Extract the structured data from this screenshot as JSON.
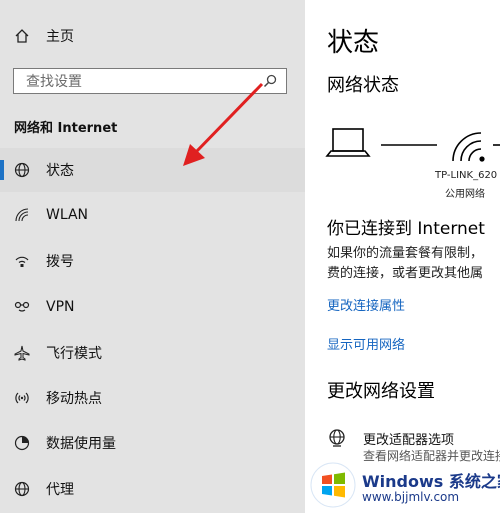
{
  "sidebar": {
    "home_label": "主页",
    "search_placeholder": "查找设置",
    "section_title": "网络和 Internet",
    "items": [
      {
        "label": "状态",
        "icon": "globe-icon",
        "active": true
      },
      {
        "label": "WLAN",
        "icon": "wifi-icon"
      },
      {
        "label": "拨号",
        "icon": "dialup-icon"
      },
      {
        "label": "VPN",
        "icon": "vpn-icon"
      },
      {
        "label": "飞行模式",
        "icon": "airplane-icon"
      },
      {
        "label": "移动热点",
        "icon": "hotspot-icon"
      },
      {
        "label": "数据使用量",
        "icon": "data-usage-icon"
      },
      {
        "label": "代理",
        "icon": "globe-icon"
      }
    ]
  },
  "main": {
    "title": "状态",
    "network_status_heading": "网络状态",
    "network_name": "TP-LINK_620",
    "network_type": "公用网络",
    "connected_text": "你已连接到 Internet",
    "desc_line1": "如果你的流量套餐有限制，",
    "desc_line2": "费的连接，或者更改其他属",
    "link_change_props": "更改连接属性",
    "link_show_networks": "显示可用网络",
    "change_settings_heading": "更改网络设置",
    "adapter_options_label": "更改适配器选项",
    "adapter_options_sub": "查看网络适配器并更改连接设置"
  },
  "watermark": {
    "brand": "Windows 系统之家",
    "url": "www.bjjmlv.com"
  },
  "colors": {
    "sidebar_bg": "#e3e3e3",
    "accent": "#1e73c6",
    "link": "#1565c0",
    "arrow": "#e02020"
  }
}
